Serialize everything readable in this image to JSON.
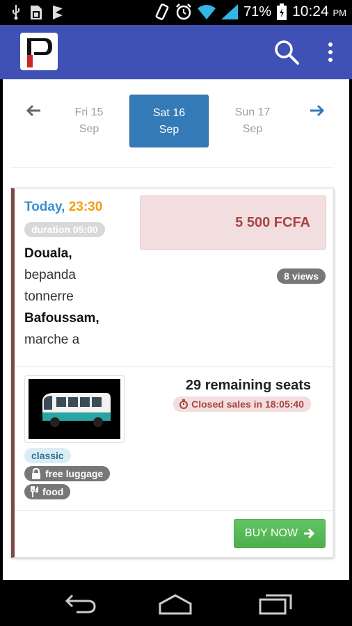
{
  "status_bar": {
    "battery": "71%",
    "time": "10:24",
    "ampm": "PM"
  },
  "date_nav": {
    "days": [
      {
        "day": "Fri 15",
        "month": "Sep"
      },
      {
        "day": "Sat 16",
        "month": "Sep"
      },
      {
        "day": "Sun 17",
        "month": "Sep"
      }
    ]
  },
  "trip": {
    "when_label": "Today,",
    "departure_time": "23:30",
    "duration": "duration 05:00",
    "origin_city": "Douala,",
    "origin_stop_1": "bepanda",
    "origin_stop_2": "tonnerre",
    "destination_city": "Bafoussam,",
    "destination_stop": "marche a",
    "price": "5 500 FCFA",
    "views": "8 views",
    "seats": "29 remaining seats",
    "closed_sales": "Closed sales in 18:05:40",
    "class_tag": "classic",
    "luggage_tag": "free luggage",
    "food_tag": "food",
    "buy_label": "BUY NOW"
  },
  "colors": {
    "app_bar": "#3f51b5",
    "active_day": "#337ab7",
    "buy": "#5cb85c",
    "price_bg": "#f2dede",
    "accent_time": "#f39c12",
    "today": "#3a8fd0"
  }
}
